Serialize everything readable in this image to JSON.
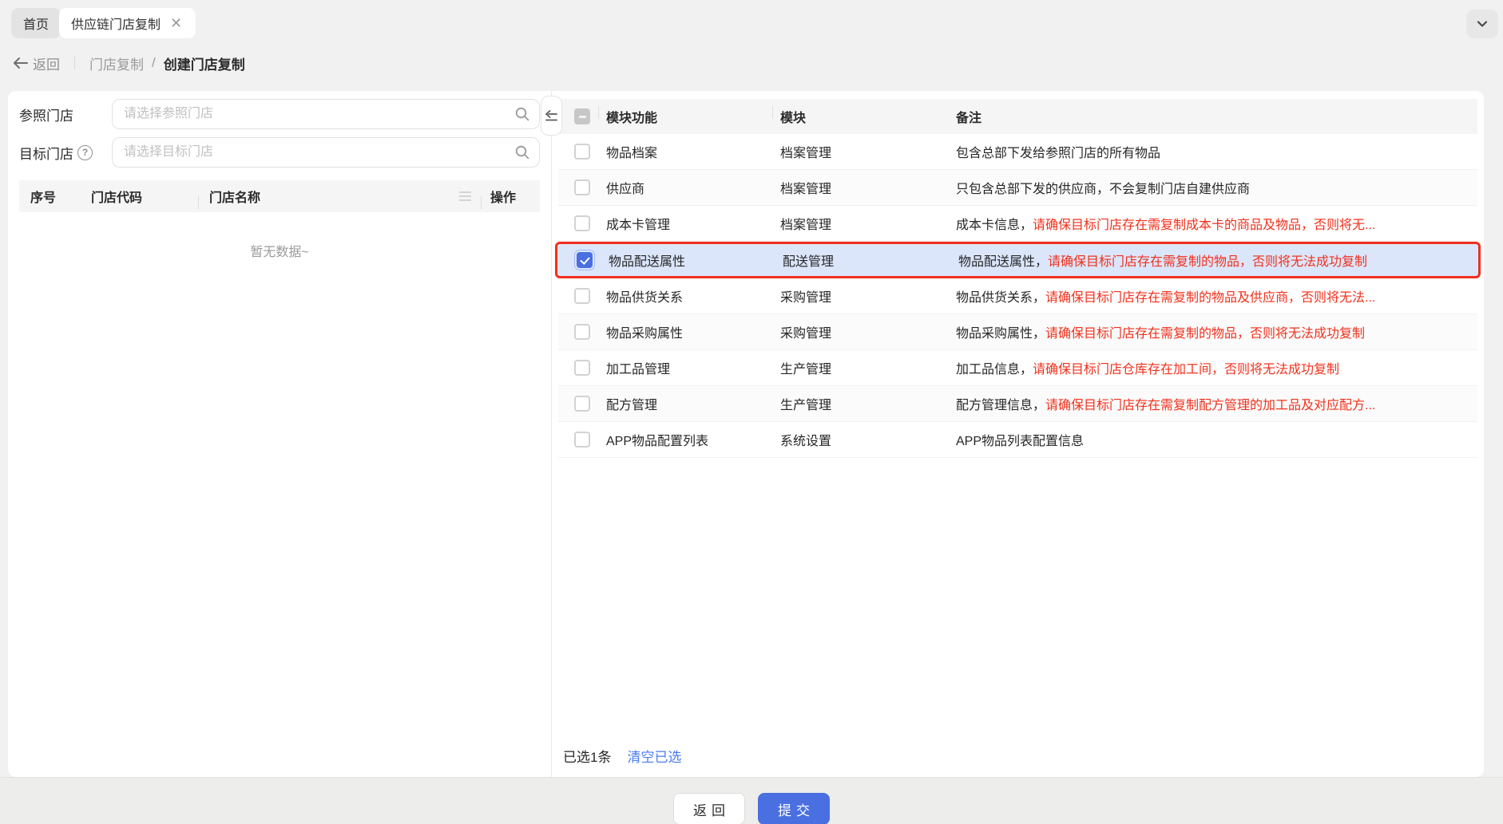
{
  "tabs": {
    "home": "首页",
    "active": "供应链门店复制"
  },
  "breadcrumb": {
    "back": "返回",
    "parent": "门店复制",
    "separator": "/",
    "current": "创建门店复制"
  },
  "left_panel": {
    "reference_label": "参照门店",
    "reference_placeholder": "请选择参照门店",
    "target_label": "目标门店",
    "target_placeholder": "请选择目标门店",
    "table_headers": [
      "序号",
      "门店代码",
      "门店名称",
      "操作"
    ],
    "empty_text": "暂无数据~"
  },
  "right_panel": {
    "headers": {
      "module_function": "模块功能",
      "module": "模块",
      "remark": "备注"
    },
    "rows": [
      {
        "name": "物品档案",
        "module": "档案管理",
        "remark_normal": "包含总部下发给参照门店的所有物品",
        "remark_warning": "",
        "checked": false,
        "selected": false
      },
      {
        "name": "供应商",
        "module": "档案管理",
        "remark_normal": "只包含总部下发的供应商，不会复制门店自建供应商",
        "remark_warning": "",
        "checked": false,
        "selected": false
      },
      {
        "name": "成本卡管理",
        "module": "档案管理",
        "remark_normal": "成本卡信息，",
        "remark_warning": "请确保目标门店存在需复制成本卡的商品及物品，否则将无...",
        "checked": false,
        "selected": false
      },
      {
        "name": "物品配送属性",
        "module": "配送管理",
        "remark_normal": "物品配送属性，",
        "remark_warning": "请确保目标门店存在需复制的物品，否则将无法成功复制",
        "checked": true,
        "selected": true
      },
      {
        "name": "物品供货关系",
        "module": "采购管理",
        "remark_normal": "物品供货关系，",
        "remark_warning": "请确保目标门店存在需复制的物品及供应商，否则将无法...",
        "checked": false,
        "selected": false
      },
      {
        "name": "物品采购属性",
        "module": "采购管理",
        "remark_normal": "物品采购属性，",
        "remark_warning": "请确保目标门店存在需复制的物品，否则将无法成功复制",
        "checked": false,
        "selected": false
      },
      {
        "name": "加工品管理",
        "module": "生产管理",
        "remark_normal": "加工品信息，",
        "remark_warning": "请确保目标门店仓库存在加工间，否则将无法成功复制",
        "checked": false,
        "selected": false
      },
      {
        "name": "配方管理",
        "module": "生产管理",
        "remark_normal": "配方管理信息，",
        "remark_warning": "请确保目标门店存在需复制配方管理的加工品及对应配方...",
        "checked": false,
        "selected": false
      },
      {
        "name": "APP物品配置列表",
        "module": "系统设置",
        "remark_normal": "APP物品列表配置信息",
        "remark_warning": "",
        "checked": false,
        "selected": false
      }
    ],
    "selected_summary": "已选1条",
    "clear_selected": "清空已选"
  },
  "footer": {
    "back_button": "返回",
    "submit_button": "提交"
  },
  "colors": {
    "accent_blue": "#4a6fe0",
    "link_blue": "#4a7cf0",
    "warning_red": "#f1301c",
    "selected_row_bg": "#dbe6fb",
    "page_bg": "#f0f1f0",
    "tab_bg": "#e3e3e3",
    "table_header_bg": "#f5f5f6"
  }
}
